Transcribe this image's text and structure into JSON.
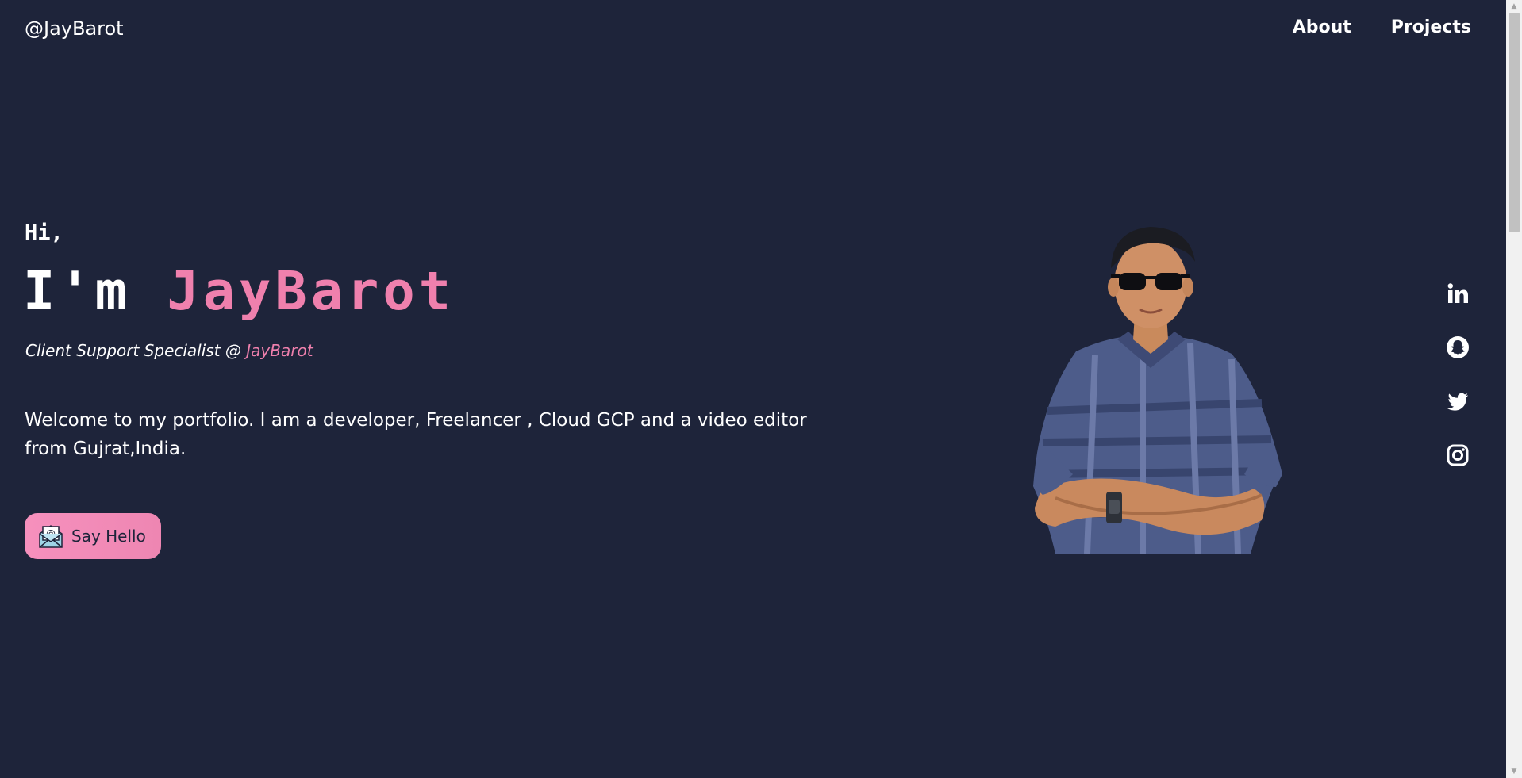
{
  "header": {
    "logo": "@JayBarot",
    "nav": [
      {
        "label": "About"
      },
      {
        "label": "Projects"
      }
    ]
  },
  "hero": {
    "greeting": "Hi,",
    "headline_prefix": "I'm ",
    "name": "JayBarot",
    "role_prefix": "Client Support Specialist @ ",
    "role_company": "JayBarot",
    "intro": "Welcome to my portfolio. I am a developer, Freelancer , Cloud GCP and a video editor from Gujrat,India.",
    "cta_label": "Say Hello",
    "cta_icon": "mail-icon"
  },
  "portrait": {
    "subject": "portrait-photo"
  },
  "social": [
    {
      "icon": "linkedin-icon"
    },
    {
      "icon": "snapchat-icon"
    },
    {
      "icon": "twitter-icon"
    },
    {
      "icon": "instagram-icon"
    }
  ],
  "colors": {
    "background": "#1e243a",
    "accent": "#ef80ad",
    "text": "#ffffff"
  }
}
